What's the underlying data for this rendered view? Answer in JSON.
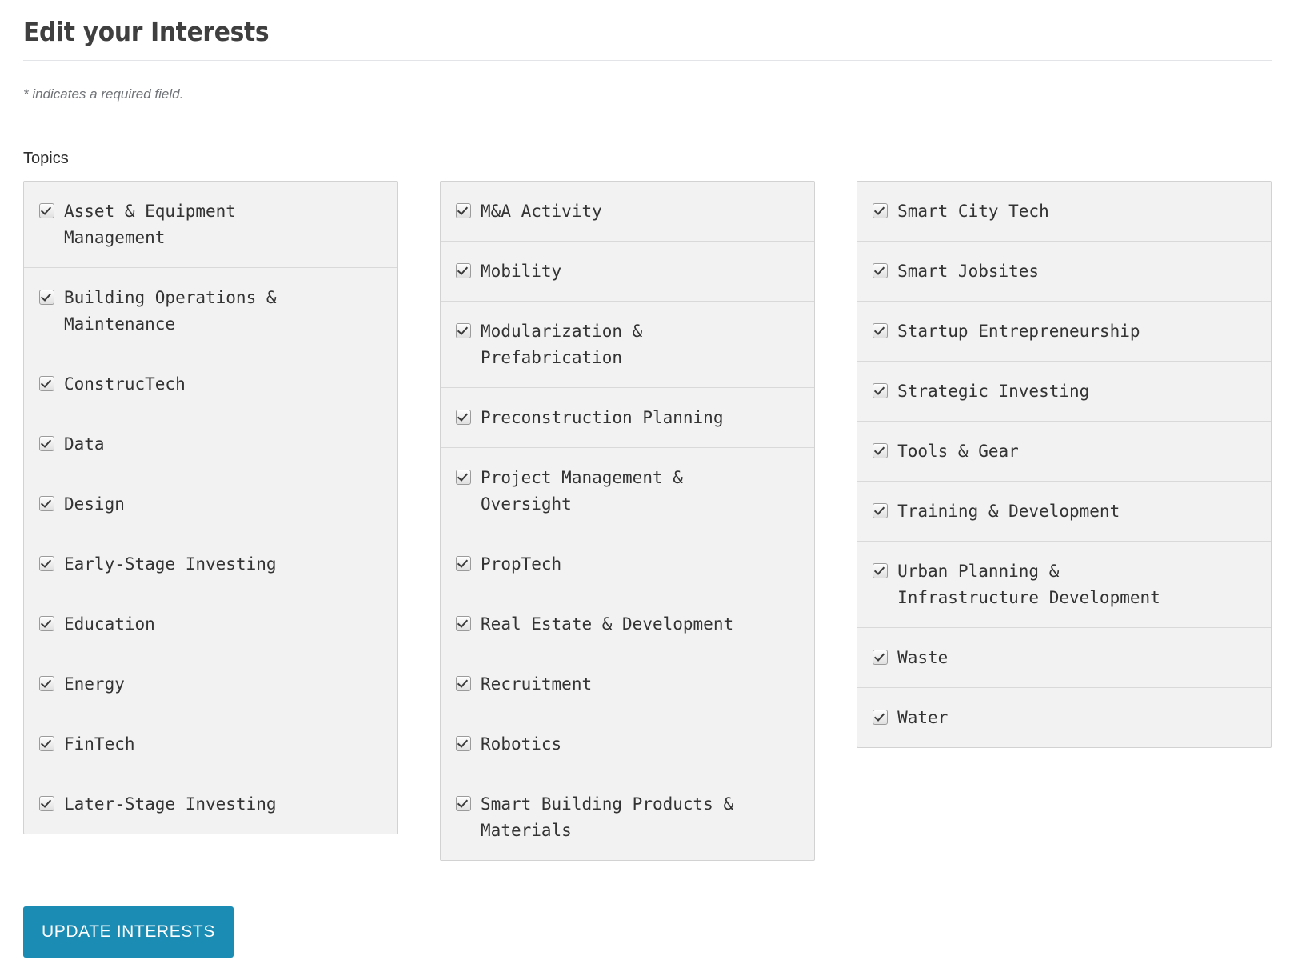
{
  "header": {
    "title": "Edit your Interests",
    "required_note": "* indicates a required field."
  },
  "form": {
    "topics_label": "Topics",
    "submit_label": "UPDATE INTERESTS",
    "accent_color": "#1b8cb4",
    "columns": [
      {
        "items": [
          {
            "label": "Asset & Equipment\nManagement",
            "checked": true
          },
          {
            "label": "Building Operations &\nMaintenance",
            "checked": true
          },
          {
            "label": "ConstrucTech",
            "checked": true
          },
          {
            "label": "Data",
            "checked": true
          },
          {
            "label": "Design",
            "checked": true
          },
          {
            "label": "Early-Stage Investing",
            "checked": true
          },
          {
            "label": "Education",
            "checked": true
          },
          {
            "label": "Energy",
            "checked": true
          },
          {
            "label": "FinTech",
            "checked": true
          },
          {
            "label": "Later-Stage Investing",
            "checked": true
          }
        ]
      },
      {
        "items": [
          {
            "label": "M&A Activity",
            "checked": true
          },
          {
            "label": "Mobility",
            "checked": true
          },
          {
            "label": "Modularization &\nPrefabrication",
            "checked": true
          },
          {
            "label": "Preconstruction Planning",
            "checked": true
          },
          {
            "label": "Project Management &\nOversight",
            "checked": true
          },
          {
            "label": "PropTech",
            "checked": true
          },
          {
            "label": "Real Estate & Development",
            "checked": true
          },
          {
            "label": "Recruitment",
            "checked": true
          },
          {
            "label": "Robotics",
            "checked": true
          },
          {
            "label": "Smart Building Products &\nMaterials",
            "checked": true
          }
        ]
      },
      {
        "items": [
          {
            "label": "Smart City Tech",
            "checked": true
          },
          {
            "label": "Smart Jobsites",
            "checked": true
          },
          {
            "label": "Startup Entrepreneurship",
            "checked": true
          },
          {
            "label": "Strategic Investing",
            "checked": true
          },
          {
            "label": "Tools & Gear",
            "checked": true
          },
          {
            "label": "Training & Development",
            "checked": true
          },
          {
            "label": "Urban Planning &\nInfrastructure Development",
            "checked": true
          },
          {
            "label": "Waste",
            "checked": true
          },
          {
            "label": "Water",
            "checked": true
          }
        ]
      }
    ]
  }
}
